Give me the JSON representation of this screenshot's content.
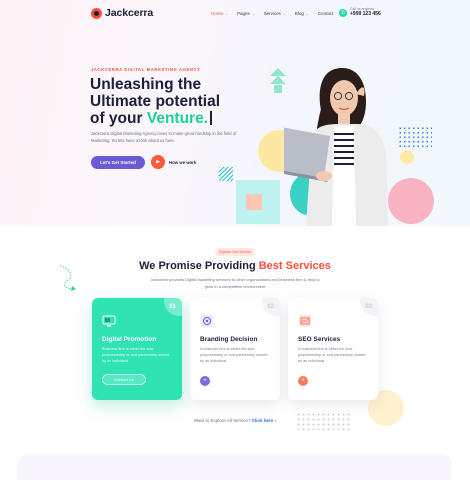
{
  "brand": {
    "name": "Jackcerra"
  },
  "nav": {
    "items": [
      {
        "label": "Home",
        "caret": "⌄"
      },
      {
        "label": "Pages",
        "caret": "⌄"
      },
      {
        "label": "Services",
        "caret": "⌄"
      },
      {
        "label": "Blog",
        "caret": "⌄"
      },
      {
        "label": "Contact",
        "caret": ""
      }
    ],
    "call_label": "Call us anytime",
    "phone": "+999 123 456"
  },
  "hero": {
    "eyebrow": "JACKCERRA DIGITAL MARKETING AGENCY",
    "title_line1": "Unleashing the",
    "title_line2": "Ultimate potential",
    "title_line3_pre": "of your ",
    "title_accent": "Venture.",
    "description": "Jackcerra Digital Marketing Agency loves to make great hardship in the field of Marketing. So lets have a look about us here.",
    "cta_label": "Let's Get Started",
    "play_label": "How we work"
  },
  "services": {
    "tag": "Explore Our Service",
    "heading_pre": "We Promise Providing ",
    "heading_accent": "Best Services",
    "subtitle": "Jackcerra provides Digital Marketing services to other organizations and business firm & help to grow in a competitive environment",
    "cards": [
      {
        "num": "01",
        "title": "Digital Promotion",
        "text": "Business firm is either the sole proprietorship or sort partnership owned by an individual.",
        "action": "Contact Us"
      },
      {
        "num": "02",
        "title": "Branding Decision",
        "text": "A business firm is either the sole proprietorship or sort partnership owned by an individual.",
        "action": "+"
      },
      {
        "num": "03",
        "title": "SEO Services",
        "text": "A business firm is either the sole proprietorship or sort partnership owned by an individual.",
        "action": "+"
      }
    ],
    "explore_text": "Want to Explore All Service?",
    "explore_link": "Click here"
  },
  "colors": {
    "accent": "#ff4d3d",
    "green": "#2fe3b3",
    "purple": "#6a5ad6",
    "text": "#1b1f3b"
  }
}
